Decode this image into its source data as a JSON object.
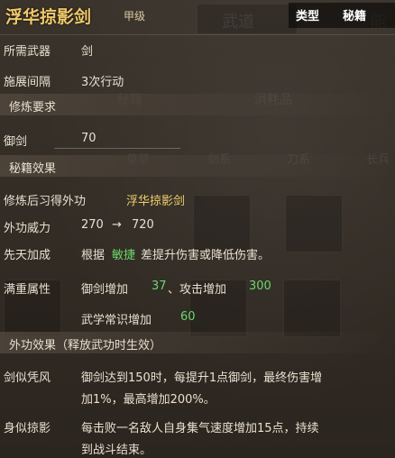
{
  "header": {
    "title": "浮华掠影剑",
    "grade": "甲级",
    "tabs": [
      "类型",
      "秘籍"
    ]
  },
  "rows": {
    "weapon": {
      "label": "所需武器",
      "value": "剑"
    },
    "interval": {
      "label": "施展间隔",
      "value": "3次行动"
    },
    "requirement_header": "修炼要求",
    "skill_req": {
      "label": "御剑",
      "value": "70"
    },
    "secret_header": "秘籍效果",
    "learn": {
      "label": "修炼后习得外功",
      "value": "浮华掠影剑"
    },
    "power": {
      "label": "外功威力",
      "from": "270",
      "arrow": "→",
      "to": "720"
    },
    "innate": {
      "label": "先天加成",
      "pre": "根据",
      "keyword": "敏捷",
      "post": "差提升伤害或降低伤害。"
    },
    "full_attr": {
      "label": "满重属性",
      "line1_a": "御剑增加",
      "line1_b": "37",
      "line1_c": "、攻击增加",
      "line1_d": "300",
      "line2_a": "武学常识增加",
      "line2_b": "60"
    },
    "external_header": "外功效果（释放武功时生效）",
    "sword_wind": {
      "label": "剑似凭风",
      "text1": "御剑达到150时，每提升1点御剑，最终伤害增",
      "text2": "加1%，最高增加200%。"
    },
    "body_shadow": {
      "label": "身似掠影",
      "text1": "每击败一名敌人自身集气速度增加15点，持续",
      "text2": "到战斗结束。"
    }
  },
  "background": {
    "ghost_texts": [
      "武道",
      "能",
      "秘籍",
      "消耗品",
      "草草",
      "剑系",
      "刀系",
      "长兵"
    ]
  }
}
